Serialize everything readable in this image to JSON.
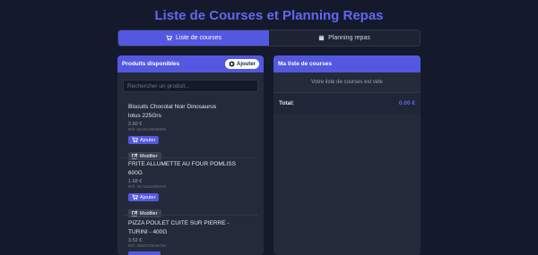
{
  "header": {
    "title": "Liste de Courses et Planning Repas"
  },
  "tabs": [
    {
      "label": "Liste de courses",
      "icon": "cart-icon",
      "active": true
    },
    {
      "label": "Planning repas",
      "icon": "calendar-icon",
      "active": false
    }
  ],
  "products_panel": {
    "title": "Produits disponibles",
    "add_label": "Ajouter",
    "search_placeholder": "Rechercher un produit...",
    "items": [
      {
        "name_line1": "Biscuits Chocolat Noir Dinosaurus",
        "name_line2": "lotus 225Grs",
        "price": "2.50 €",
        "ref": "Réf: 5410126696655",
        "add_label": "Ajouter",
        "edit_label": "Modifier"
      },
      {
        "name_line1": "FRITE ALLUMETTE AU FOUR POMLISS",
        "name_line2": "600G",
        "price": "1.68 €",
        "ref": "Réf: 3474341006070",
        "add_label": "Ajouter",
        "edit_label": "Modifier"
      },
      {
        "name_line1": "PIZZA POULET CUITE SUR PIERRE -",
        "name_line2": "TURINI - 400G",
        "price": "3.52 €",
        "ref": "Réf: 3560070945754"
      }
    ]
  },
  "list_panel": {
    "title": "Ma liste de courses",
    "empty_text": "Votre liste de courses est vide",
    "total_label": "Total:",
    "total_value": "0.00 €"
  },
  "colors": {
    "accent": "#5458e0",
    "title": "#6366f1",
    "background": "#141a2b",
    "panel": "#232b3b"
  }
}
